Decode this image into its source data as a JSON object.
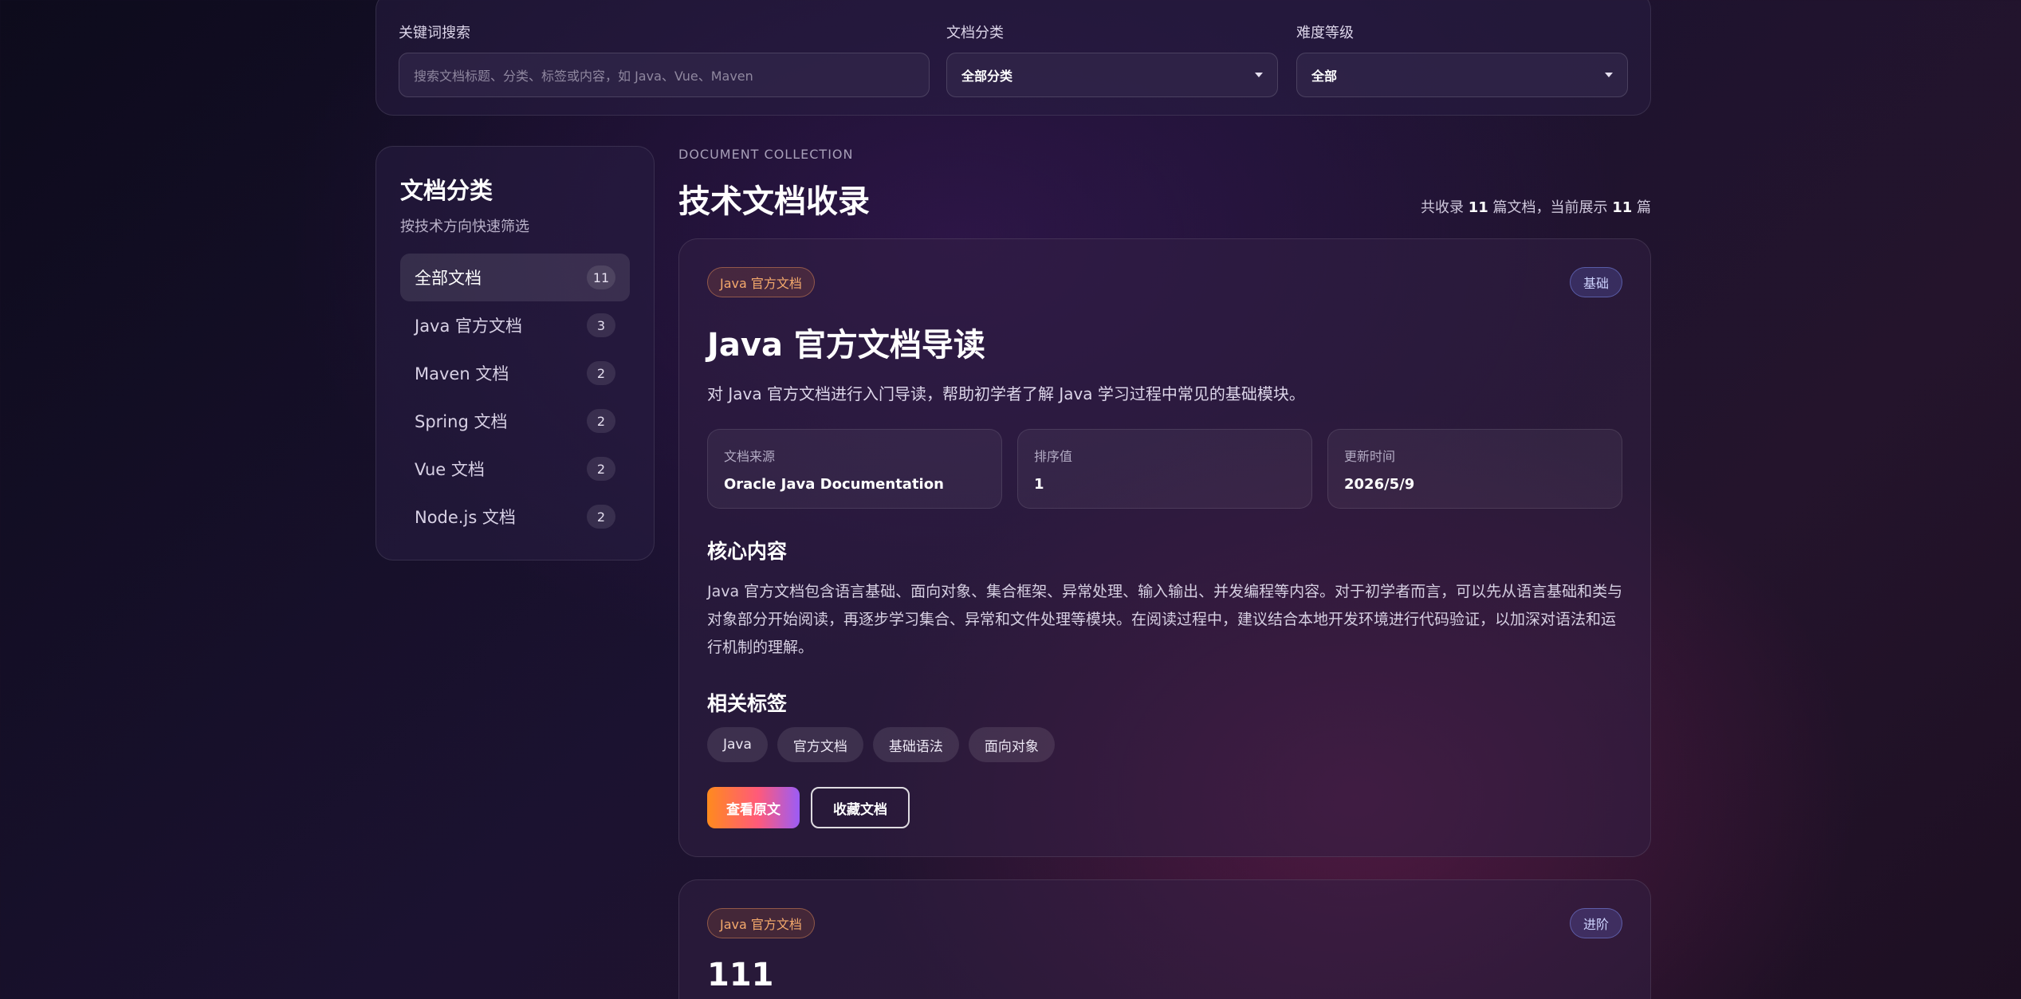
{
  "filters": {
    "keyword": {
      "label": "关键词搜索",
      "placeholder": "搜索文档标题、分类、标签或内容，如 Java、Vue、Maven"
    },
    "category": {
      "label": "文档分类",
      "value": "全部分类"
    },
    "level": {
      "label": "难度等级",
      "value": "全部"
    }
  },
  "sidebar": {
    "title": "文档分类",
    "subtitle": "按技术方向快速筛选",
    "items": [
      {
        "label": "全部文档",
        "count": "11"
      },
      {
        "label": "Java 官方文档",
        "count": "3"
      },
      {
        "label": "Maven 文档",
        "count": "2"
      },
      {
        "label": "Spring 文档",
        "count": "2"
      },
      {
        "label": "Vue 文档",
        "count": "2"
      },
      {
        "label": "Node.js 文档",
        "count": "2"
      }
    ]
  },
  "main": {
    "eyebrow": "DOCUMENT COLLECTION",
    "title": "技术文档收录",
    "stats": {
      "prefix": "共收录 ",
      "total": "11",
      "middle": " 篇文档，当前展示 ",
      "shown": "11",
      "suffix": " 篇"
    }
  },
  "docs": [
    {
      "category": "Java 官方文档",
      "level": "基础",
      "title": "Java 官方文档导读",
      "description": "对 Java 官方文档进行入门导读，帮助初学者了解 Java 学习过程中常见的基础模块。",
      "meta": [
        {
          "label": "文档来源",
          "value": "Oracle Java Documentation"
        },
        {
          "label": "排序值",
          "value": "1"
        },
        {
          "label": "更新时间",
          "value": "2026/5/9"
        }
      ],
      "core_heading": "核心内容",
      "core_text": "Java 官方文档包含语言基础、面向对象、集合框架、异常处理、输入输出、并发编程等内容。对于初学者而言，可以先从语言基础和类与对象部分开始阅读，再逐步学习集合、异常和文件处理等模块。在阅读过程中，建议结合本地开发环境进行代码验证，以加深对语法和运行机制的理解。",
      "tags_heading": "相关标签",
      "tags": [
        "Java",
        "官方文档",
        "基础语法",
        "面向对象"
      ],
      "primary_action": "查看原文",
      "secondary_action": "收藏文档"
    },
    {
      "category": "Java 官方文档",
      "level": "进阶",
      "title": "111"
    }
  ],
  "colors": {
    "accent_gradient": [
      "#ff8a1e",
      "#ff5a7a",
      "#9b5cf6"
    ],
    "category_pill": "#f4a96c",
    "level_pill": "#cfd4ff"
  }
}
